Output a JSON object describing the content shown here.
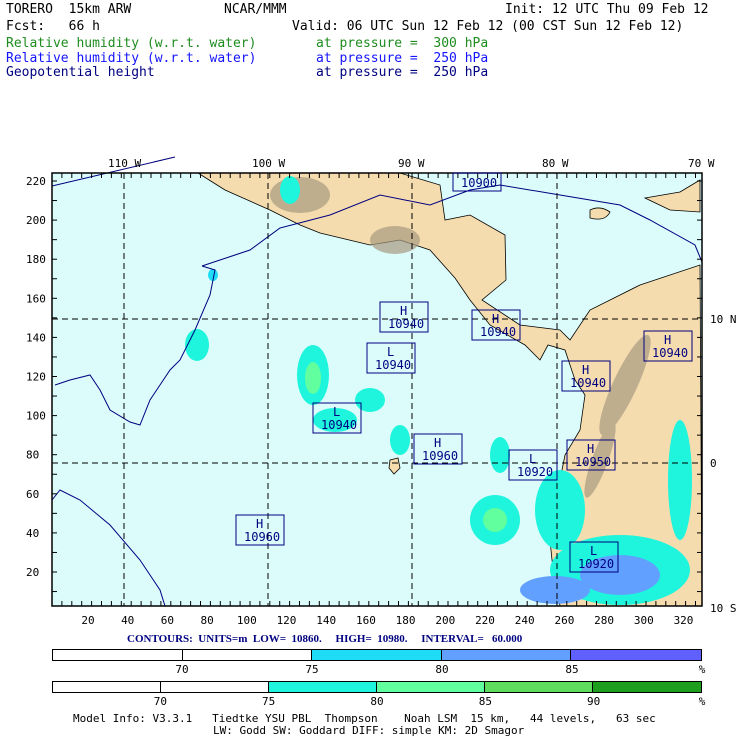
{
  "header": {
    "model": "TORERO  15km ARW",
    "org": "NCAR/MMM",
    "init": "Init: 12 UTC Thu 09 Feb 12",
    "fcst": "Fcst:   66 h",
    "valid": "Valid: 06 UTC Sun 12 Feb 12 (00 CST Sun 12 Feb 12)",
    "fields": [
      {
        "name": "Relative humidity (w.r.t. water)",
        "level": "at pressure =  300 hPa",
        "color": "#1e8c1e"
      },
      {
        "name": "Relative humidity (w.r.t. water)",
        "level": "at pressure =  250 hPa",
        "color": "#1414ff"
      },
      {
        "name": "Geopotential height",
        "level": "at pressure =  250 hPa",
        "color": "#000080"
      }
    ]
  },
  "map": {
    "lon_labels": [
      "110 W",
      "100 W",
      "90 W",
      "80 W",
      "70 W"
    ],
    "lat_labels": [
      "10 N",
      "0",
      "10 S"
    ],
    "y_ticks": [
      "220",
      "200",
      "180",
      "160",
      "140",
      "120",
      "100",
      "80",
      "60",
      "40",
      "20"
    ],
    "x_ticks": [
      "20",
      "40",
      "60",
      "80",
      "100",
      "120",
      "140",
      "160",
      "180",
      "200",
      "220",
      "240",
      "260",
      "280",
      "300",
      "320"
    ],
    "centers": [
      {
        "type": "",
        "value": "10900"
      },
      {
        "type": "H",
        "value": "10940"
      },
      {
        "type": "H",
        "value": "10940"
      },
      {
        "type": "L",
        "value": "10940"
      },
      {
        "type": "H",
        "value": "10940"
      },
      {
        "type": "H",
        "value": "10940"
      },
      {
        "type": "L",
        "value": "10940"
      },
      {
        "type": "H",
        "value": "10960"
      },
      {
        "type": "L",
        "value": "10920"
      },
      {
        "type": "H",
        "value": "10950"
      },
      {
        "type": "H",
        "value": "10960"
      },
      {
        "type": "L",
        "value": "10920"
      }
    ]
  },
  "contours": "CONTOURS:  UNITS=m  LOW=  10860.     HIGH=  10980.     INTERVAL=   60.000",
  "colorbar_250": {
    "labels": [
      "70",
      "75",
      "80",
      "85",
      "%"
    ],
    "colors": [
      "#ffffff",
      "#ffffff",
      "#1edcf5",
      "#62a0ff",
      "#6060ff"
    ]
  },
  "colorbar_300": {
    "labels": [
      "70",
      "75",
      "80",
      "85",
      "90",
      "%"
    ],
    "colors": [
      "#ffffff",
      "#ffffff",
      "#1ef5dc",
      "#62ff9e",
      "#5ddc5d",
      "#1e9e1e"
    ]
  },
  "footer": {
    "line1": "Model Info: V3.3.1   Tiedtke YSU PBL  Thompson    Noah LSM  15 km,   44 levels,   63 sec",
    "line2": "LW: Godd SW: Goddard DIFF: simple KM: 2D Smagor"
  }
}
